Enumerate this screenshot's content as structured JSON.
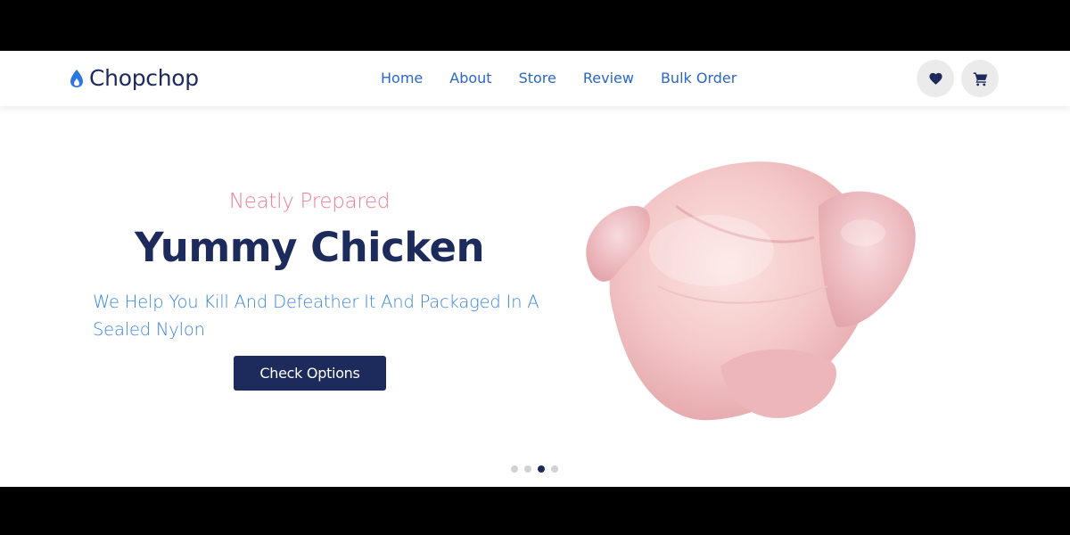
{
  "brand": {
    "name": "Chopchop",
    "accent": "#1d2a5c",
    "logo_icon": "flame-icon"
  },
  "nav": {
    "items": [
      {
        "label": "Home"
      },
      {
        "label": "About"
      },
      {
        "label": "Store"
      },
      {
        "label": "Review"
      },
      {
        "label": "Bulk Order"
      }
    ]
  },
  "actions": {
    "wishlist_icon": "heart-icon",
    "cart_icon": "cart-icon"
  },
  "hero": {
    "subtitle": "Neatly Prepared",
    "title": "Yummy Chicken",
    "description": "We Help You Kill And Defeather It And Packaged In A Sealed Nylon",
    "cta_label": "Check Options",
    "image": "raw-chicken-image"
  },
  "carousel": {
    "slides": 4,
    "active_slide": 3
  },
  "colors": {
    "nav_link": "#2a67c7",
    "subtitle": "#ef7f95",
    "description": "#3a86dc"
  }
}
